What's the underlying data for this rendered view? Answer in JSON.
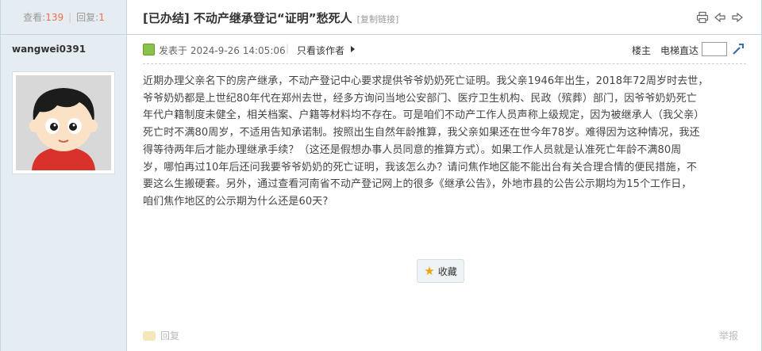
{
  "sidebar": {
    "views_label": "查看:",
    "views_count": "139",
    "replies_label": "回复:",
    "replies_count": "1",
    "author": "wangwei0391"
  },
  "header": {
    "title": "[已办结] 不动产继承登记“证明”愁死人",
    "copy_link": "[复制链接]",
    "icons": [
      "print-icon",
      "prev-icon",
      "next-icon"
    ]
  },
  "meta": {
    "posted": "发表于 2024-9-26 14:05:06",
    "only_author": "只看该作者",
    "floor": "楼主",
    "jump_label": "电梯直达"
  },
  "post": {
    "lines": [
      "近期办理父亲名下的房产继承，不动产登记中心要求提供爷爷奶奶死亡证明。我父亲1946年出生，2018年72周岁时去世，",
      "爷爷奶奶都是上世纪80年代在郑州去世，经多方询问当地公安部门、医疗卫生机构、民政（殡葬）部门，因爷爷奶奶死亡",
      "年代户籍制度未健全，相关档案、户籍等材料均不存在。可是咱们不动产工作人员声称上级规定，因为被继承人（我父亲）",
      "死亡时不满80周岁，不适用告知承诺制。按照出生自然年龄推算，我父亲如果还在世今年78岁。难得因为这种情况，我还",
      "得等待两年后才能办理继承手续？（这还是假想办事人员同意的推算方式）。如果工作人员就是认准死亡年龄不满80周",
      "岁，哪怕再过10年后还问我要爷爷奶奶的死亡证明，我该怎么办？请问焦作地区能不能出台有关合理合情的便民措施，不",
      "要这么生搬硬套。另外，通过查看河南省不动产登记网上的很多《继承公告》，外地市县的公告公示期均为15个工作日，",
      "咱们焦作地区的公示期为什么还是60天?"
    ]
  },
  "actions": {
    "favorite": "收藏",
    "reply": "回复",
    "report": "举报"
  }
}
